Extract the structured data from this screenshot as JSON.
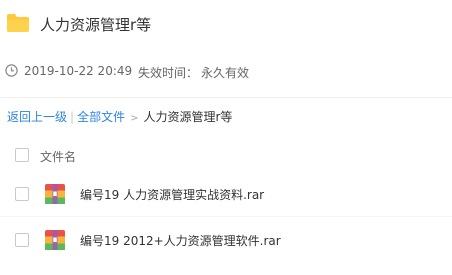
{
  "header": {
    "title": "人力资源管理r等"
  },
  "meta": {
    "date": "2019-10-22 20:49",
    "expire_label": "失效时间：",
    "expire_value": "永久有效"
  },
  "breadcrumb": {
    "back": "返回上一级",
    "separator": "|",
    "all_files": "全部文件",
    "arrow": ">",
    "current": "人力资源管理r等"
  },
  "table": {
    "column_header": "文件名",
    "rows": [
      {
        "name": "编号19 人力资源管理实战资料.rar",
        "icon": "rar-archive-icon"
      },
      {
        "name": "编号19 2012+人力资源管理软件.rar",
        "icon": "rar-archive-icon"
      }
    ]
  },
  "colors": {
    "link": "#2e84e6",
    "folder": "#ffc93e",
    "text": "#333333",
    "muted": "#666666"
  }
}
